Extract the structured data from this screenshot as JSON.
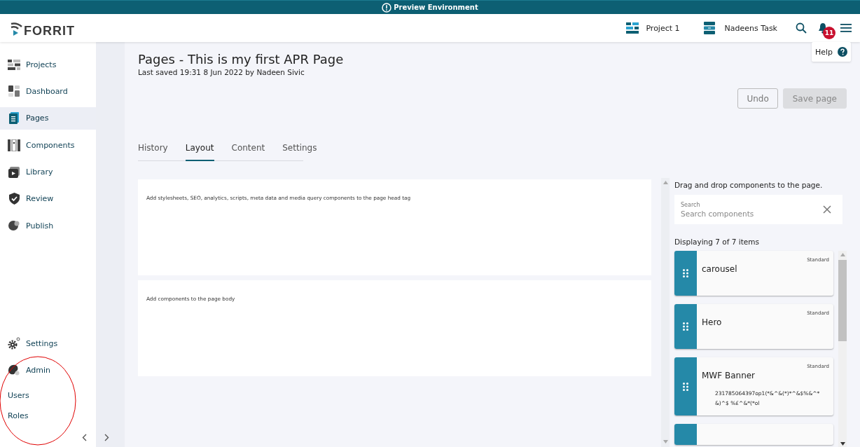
{
  "banner": {
    "text": "Preview Environment"
  },
  "header": {
    "logo": "FORRIT",
    "project": "Project 1",
    "task": "Nadeens Task",
    "notifications": "11",
    "help": "Help"
  },
  "sidebar": {
    "items": [
      {
        "label": "Projects",
        "selected": false
      },
      {
        "label": "Dashboard",
        "selected": false
      },
      {
        "label": "Pages",
        "selected": true
      },
      {
        "label": "Components",
        "selected": false
      },
      {
        "label": "Library",
        "selected": false
      },
      {
        "label": "Review",
        "selected": false
      },
      {
        "label": "Publish",
        "selected": false
      }
    ],
    "bottom_items": [
      {
        "kind": "nav",
        "label": "Settings"
      },
      {
        "kind": "nav",
        "label": "Admin"
      },
      {
        "kind": "sub",
        "label": "Users"
      },
      {
        "kind": "sub",
        "label": "Roles"
      }
    ]
  },
  "page": {
    "title": "Pages - This is my first APR Page",
    "subtitle": "Last saved 19:31 8 Jun 2022 by Nadeen Sivic",
    "buttons": [
      {
        "label": "Undo",
        "disabled": false
      },
      {
        "label": "Save page",
        "disabled": true
      }
    ]
  },
  "tabs": [
    {
      "label": "History",
      "selected": false
    },
    {
      "label": "Layout",
      "selected": true
    },
    {
      "label": "Content",
      "selected": false
    },
    {
      "label": "Settings",
      "selected": false
    }
  ],
  "panels": [
    {
      "text": "Add stylesheets, SEO, analytics, scripts, meta data and media query components to the page head tag"
    },
    {
      "text": "Add components to the page body"
    }
  ],
  "components_panel": {
    "hint": "Drag and drop components to the page.",
    "search_label": "Search",
    "search_placeholder": "Search components",
    "count": "Displaying 7 of 7 items",
    "items": [
      {
        "kind": "card",
        "title": "carousel",
        "badge": "Standard"
      },
      {
        "kind": "card",
        "title": "Hero",
        "badge": "Standard"
      },
      {
        "kind": "card",
        "title": "MWF Banner",
        "badge": "Standard",
        "description": "231785064397op1(*&^&(*)*^&$%&^*&)^$ %£^&*(*ol"
      },
      {
        "kind": "cut"
      }
    ]
  }
}
